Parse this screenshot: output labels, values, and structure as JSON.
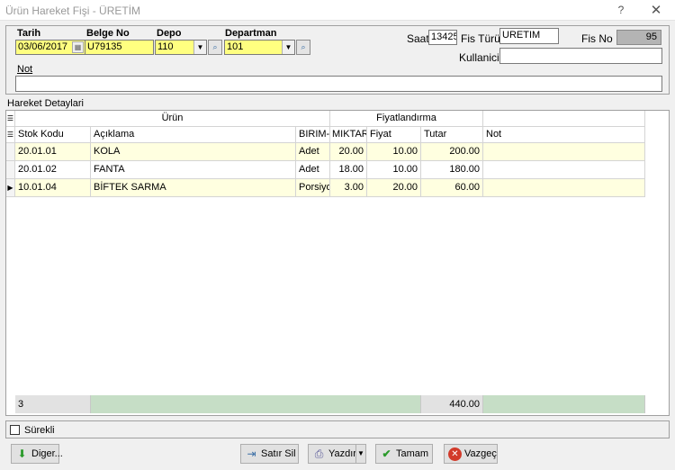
{
  "window": {
    "title": "Ürün Hareket Fişi - ÜRETİM",
    "help": "?",
    "close": "✕"
  },
  "header": {
    "tarih_label": "Tarih",
    "tarih_value": "03/06/2017",
    "belge_label": "Belge No",
    "belge_value": "U79135",
    "depo_label": "Depo",
    "depo_value": "110",
    "departman_label": "Departman",
    "departman_value": "101",
    "saat_label": "Saat",
    "saat_value": "13425",
    "fis_turu_label": "Fis Türü",
    "fis_turu_value": "URETIM",
    "fis_no_label": "Fis No",
    "fis_no_value": "95",
    "kullanici_label": "Kullanici",
    "kullanici_value": "",
    "not_label": "Not",
    "not_value": ""
  },
  "grid": {
    "caption": "Hareket Detaylari",
    "band_urun": "Ürün",
    "band_fiyat": "Fiyatlandırma",
    "columns": [
      "Stok Kodu",
      "Açıklama",
      "BIRIM-",
      "MIKTAR",
      "Fiyat",
      "Tutar",
      "Not"
    ],
    "rows": [
      {
        "stok": "20.01.01",
        "aciklama": "KOLA",
        "birim": "Adet",
        "miktar": "20.00",
        "fiyat": "10.00",
        "tutar": "200.00",
        "not": ""
      },
      {
        "stok": "20.01.02",
        "aciklama": "FANTA",
        "birim": "Adet",
        "miktar": "18.00",
        "fiyat": "10.00",
        "tutar": "180.00",
        "not": ""
      },
      {
        "stok": "10.01.04",
        "aciklama": "BİFTEK SARMA",
        "birim": "Porsiyon",
        "miktar": "3.00",
        "fiyat": "20.00",
        "tutar": "60.00",
        "not": ""
      }
    ],
    "footer_count": "3",
    "footer_total": "440.00"
  },
  "options": {
    "surekli_label": "Sürekli"
  },
  "buttons": {
    "diger": "Diger...",
    "satir_sil": "Satır Sil",
    "yazdir": "Yazdır",
    "tamam": "Tamam",
    "vazgec": "Vazgeç"
  },
  "colors": {
    "required_field": "#ffff80",
    "selected_row": "#ffffe0",
    "footer_band": "#c6dec6"
  }
}
